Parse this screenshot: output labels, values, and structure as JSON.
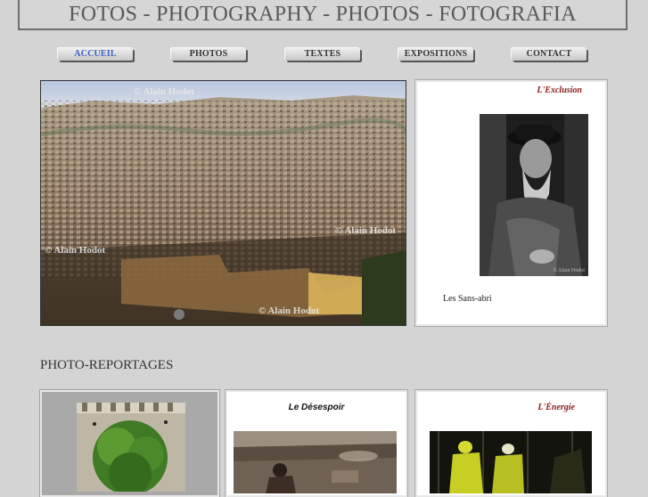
{
  "banner": {
    "title": "FOTOS - PHOTOGRAPHY - PHOTOS - FOTOGRAFIA"
  },
  "nav": [
    {
      "label": "ACCUEIL",
      "active": true
    },
    {
      "label": "PHOTOS",
      "active": false
    },
    {
      "label": "TEXTES",
      "active": false
    },
    {
      "label": "EXPOSITIONS",
      "active": false
    },
    {
      "label": "CONTACT",
      "active": false
    }
  ],
  "hero": {
    "watermark": "© Alain Hodot"
  },
  "exclusion": {
    "title": "L'Exclusion",
    "caption": "Les Sans-abri",
    "photo_watermark": "© Alain Hodot"
  },
  "section": {
    "heading": "PHOTO-REPORTAGES"
  },
  "reportages": [
    {
      "title": ""
    },
    {
      "title": "Le Désespoir"
    },
    {
      "title": "L'Énergie"
    }
  ],
  "colors": {
    "background": "#d4d4d4",
    "active_nav": "#3a5fc4",
    "caption": "#8b1a1a"
  }
}
